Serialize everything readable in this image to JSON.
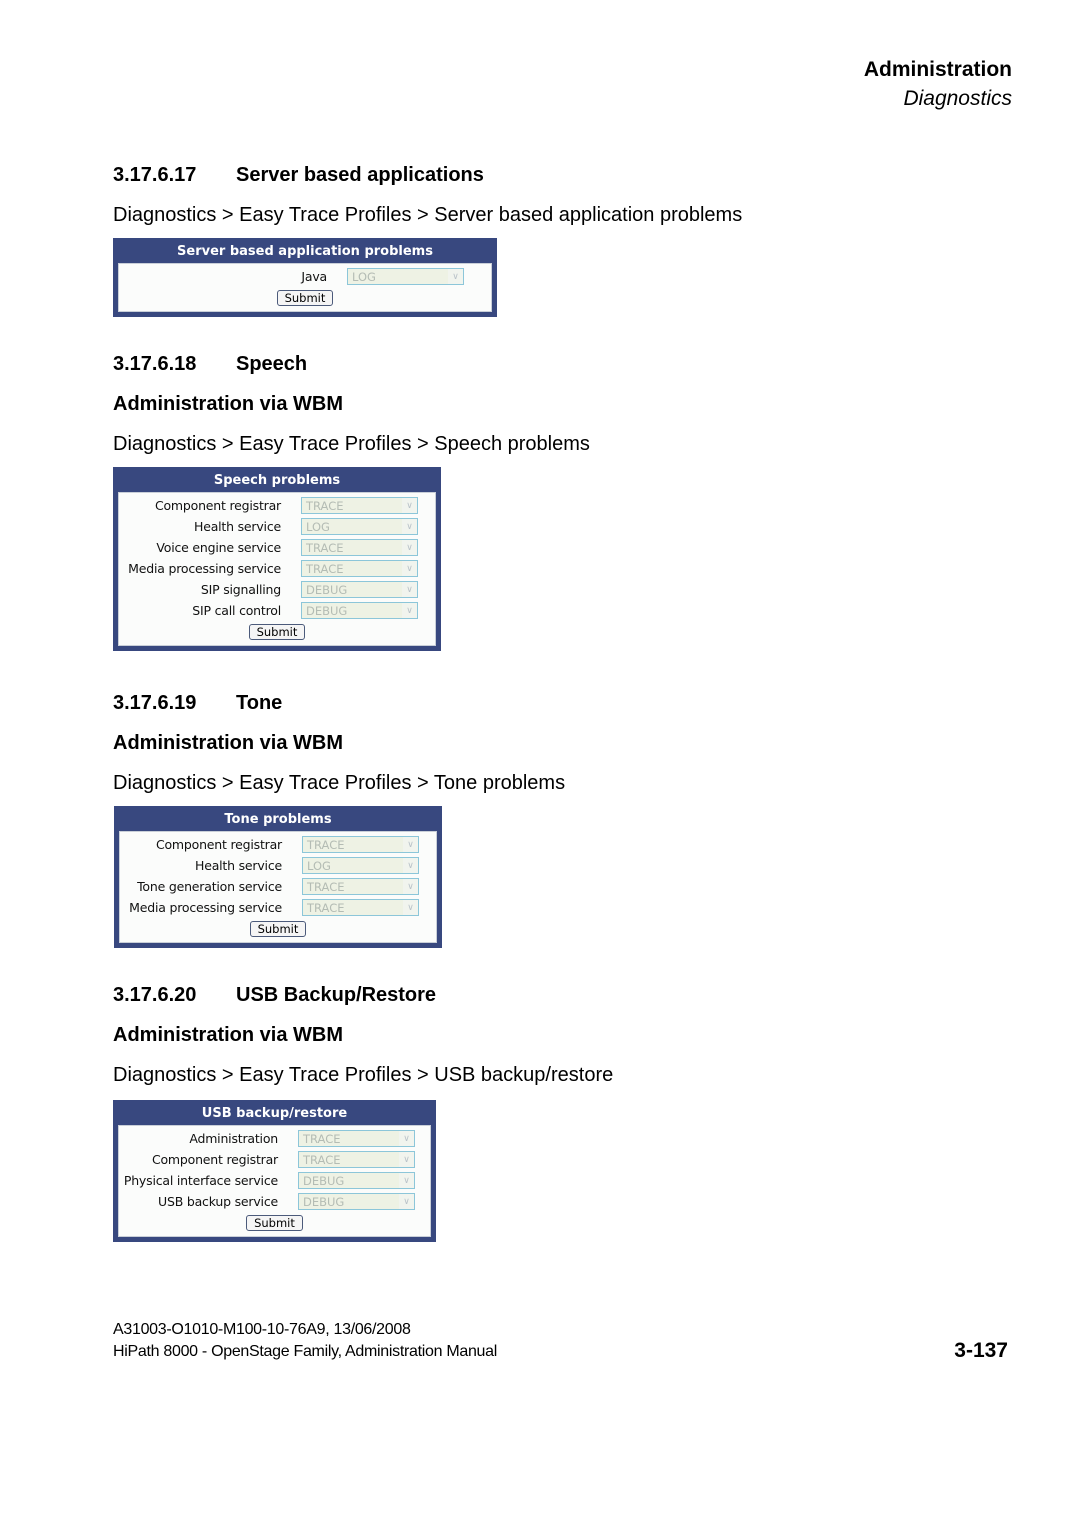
{
  "header": {
    "chapter": "Administration",
    "section": "Diagnostics"
  },
  "sections": [
    {
      "number": "3.17.6.17",
      "title": "Server based applications",
      "subtitle": "",
      "path": "Diagnostics > Easy Trace Profiles > Server based application problems",
      "panel": {
        "title": "Server based application problems",
        "rows": [
          {
            "label": "Java",
            "value": "LOG"
          }
        ],
        "submit_label": "Submit"
      }
    },
    {
      "number": "3.17.6.18",
      "title": "Speech",
      "subtitle": "Administration via WBM",
      "path": "Diagnostics > Easy Trace Profiles > Speech problems",
      "panel": {
        "title": "Speech problems",
        "rows": [
          {
            "label": "Component registrar",
            "value": "TRACE"
          },
          {
            "label": "Health service",
            "value": "LOG"
          },
          {
            "label": "Voice engine service",
            "value": "TRACE"
          },
          {
            "label": "Media processing service",
            "value": "TRACE"
          },
          {
            "label": "SIP signalling",
            "value": "DEBUG"
          },
          {
            "label": "SIP call control",
            "value": "DEBUG"
          }
        ],
        "submit_label": "Submit"
      }
    },
    {
      "number": "3.17.6.19",
      "title": "Tone",
      "subtitle": "Administration via WBM",
      "path": "Diagnostics > Easy Trace Profiles > Tone problems",
      "panel": {
        "title": "Tone problems",
        "rows": [
          {
            "label": "Component registrar",
            "value": "TRACE"
          },
          {
            "label": "Health service",
            "value": "LOG"
          },
          {
            "label": "Tone generation service",
            "value": "TRACE"
          },
          {
            "label": "Media processing service",
            "value": "TRACE"
          }
        ],
        "submit_label": "Submit"
      }
    },
    {
      "number": "3.17.6.20",
      "title": "USB Backup/Restore",
      "subtitle": "Administration via WBM",
      "path": "Diagnostics > Easy Trace Profiles > USB backup/restore",
      "panel": {
        "title": "USB backup/restore",
        "rows": [
          {
            "label": "Administration",
            "value": "TRACE"
          },
          {
            "label": "Component registrar",
            "value": "TRACE"
          },
          {
            "label": "Physical interface service",
            "value": "DEBUG"
          },
          {
            "label": "USB backup service",
            "value": "DEBUG"
          }
        ],
        "submit_label": "Submit"
      }
    }
  ],
  "footer": {
    "doc_id": "A31003-O1010-M100-10-76A9, 13/06/2008",
    "manual": "HiPath 8000 - OpenStage Family, Administration Manual",
    "page": "3-137"
  }
}
